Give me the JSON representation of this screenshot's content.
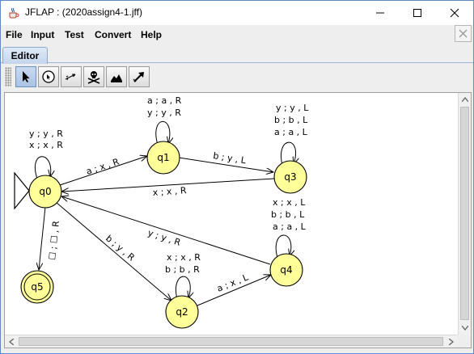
{
  "window": {
    "title": "JFLAP : (2020assign4-1.jff)"
  },
  "menu": [
    "File",
    "Input",
    "Test",
    "Convert",
    "Help"
  ],
  "tabs": [
    {
      "label": "Editor"
    }
  ],
  "toolbar": {
    "tools": [
      {
        "name": "attribute-editor",
        "icon": "pointer-arrow-icon",
        "active": true
      },
      {
        "name": "state-creator",
        "icon": "state-creator-icon",
        "active": false
      },
      {
        "name": "transition-creator",
        "icon": "transition-arrow-icon",
        "active": false
      },
      {
        "name": "deleter",
        "icon": "skull-crossbones-icon",
        "active": false
      },
      {
        "name": "undo",
        "icon": "undo-stack-icon",
        "active": false
      },
      {
        "name": "redo",
        "icon": "redo-arrow-icon",
        "active": false
      }
    ]
  },
  "automaton": {
    "states": [
      {
        "id": "q0",
        "label": "q0",
        "initial": true,
        "final": false
      },
      {
        "id": "q1",
        "label": "q1",
        "initial": false,
        "final": false
      },
      {
        "id": "q2",
        "label": "q2",
        "initial": false,
        "final": false
      },
      {
        "id": "q3",
        "label": "q3",
        "initial": false,
        "final": false
      },
      {
        "id": "q4",
        "label": "q4",
        "initial": false,
        "final": false
      },
      {
        "id": "q5",
        "label": "q5",
        "initial": false,
        "final": true
      }
    ],
    "transitions": [
      {
        "from": "q0",
        "to": "q0",
        "labels": [
          "y ; y , R",
          "x ; x , R"
        ]
      },
      {
        "from": "q1",
        "to": "q1",
        "labels": [
          "a ; a , R",
          "y ; y , R"
        ]
      },
      {
        "from": "q3",
        "to": "q3",
        "labels": [
          "y ; y , L",
          "b ; b , L",
          "a ; a , L"
        ]
      },
      {
        "from": "q4",
        "to": "q4",
        "labels": [
          "x ; x , L",
          "b ; b , L",
          "a ; a , L"
        ]
      },
      {
        "from": "q2",
        "to": "q2",
        "labels": [
          "x ; x , R",
          "b ; b , R"
        ]
      },
      {
        "from": "q0",
        "to": "q1",
        "labels": [
          "a ; x , R"
        ]
      },
      {
        "from": "q1",
        "to": "q3",
        "labels": [
          "b ; y , L"
        ]
      },
      {
        "from": "q3",
        "to": "q0",
        "labels": [
          "x ; x , R"
        ]
      },
      {
        "from": "q0",
        "to": "q5",
        "labels": [
          "☐ ; ☐ , R"
        ]
      },
      {
        "from": "q0",
        "to": "q2",
        "labels": [
          "b ; y , R"
        ]
      },
      {
        "from": "q4",
        "to": "q0",
        "labels": [
          "y ; y , R"
        ]
      },
      {
        "from": "q2",
        "to": "q4",
        "labels": [
          "a ; x , L"
        ]
      }
    ]
  },
  "colors": {
    "state_fill": "#ffff99",
    "state_stroke": "#000000",
    "selection": "#a9c3e4"
  }
}
